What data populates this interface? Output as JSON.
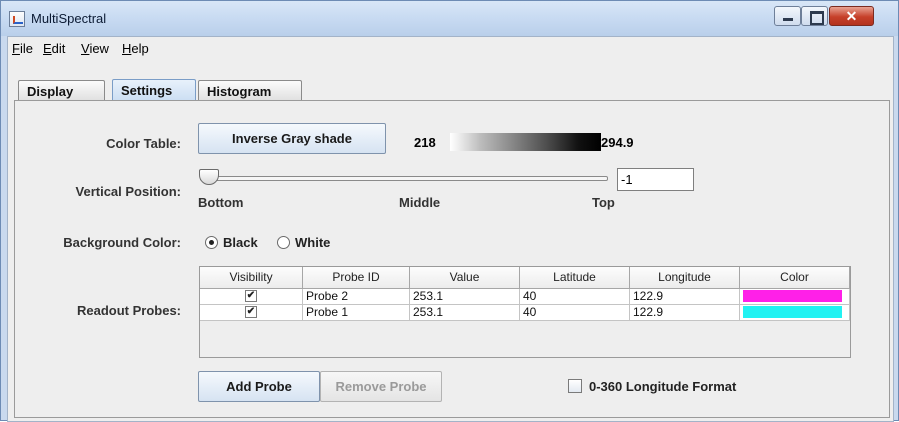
{
  "window": {
    "title": "MultiSpectral",
    "close_glyph": "✕"
  },
  "menu": {
    "file": "File",
    "edit": "Edit",
    "view": "View",
    "help": "Help"
  },
  "tabs": [
    {
      "label": "Display"
    },
    {
      "label": "Settings",
      "selected": true
    },
    {
      "label": "Histogram"
    }
  ],
  "settings": {
    "color_table": {
      "label": "Color Table:",
      "button": "Inverse Gray shade",
      "min": "218",
      "max": "294.9"
    },
    "vertical_position": {
      "label": "Vertical Position:",
      "value": "-1",
      "ticks": [
        "Bottom",
        "Middle",
        "Top"
      ],
      "slider_fraction": 0.0
    },
    "background_color": {
      "label": "Background Color:",
      "options": [
        "Black",
        "White"
      ],
      "selected": "Black"
    },
    "readout_probes": {
      "label": "Readout Probes:",
      "columns": [
        "Visibility",
        "Probe ID",
        "Value",
        "Latitude",
        "Longitude",
        "Color"
      ],
      "rows": [
        {
          "visible": true,
          "check": "✔",
          "probe_id": "Probe 2",
          "value": "253.1",
          "latitude": "40",
          "longitude": "122.9",
          "color": "#ff20e8"
        },
        {
          "visible": true,
          "check": "✔",
          "probe_id": "Probe 1",
          "value": "253.1",
          "latitude": "40",
          "longitude": "122.9",
          "color": "#22f2f2"
        }
      ]
    },
    "buttons": {
      "add_probe": "Add Probe",
      "remove_probe": "Remove Probe"
    },
    "longitude_format": {
      "label": "0-360 Longitude Format",
      "checked": false
    }
  }
}
